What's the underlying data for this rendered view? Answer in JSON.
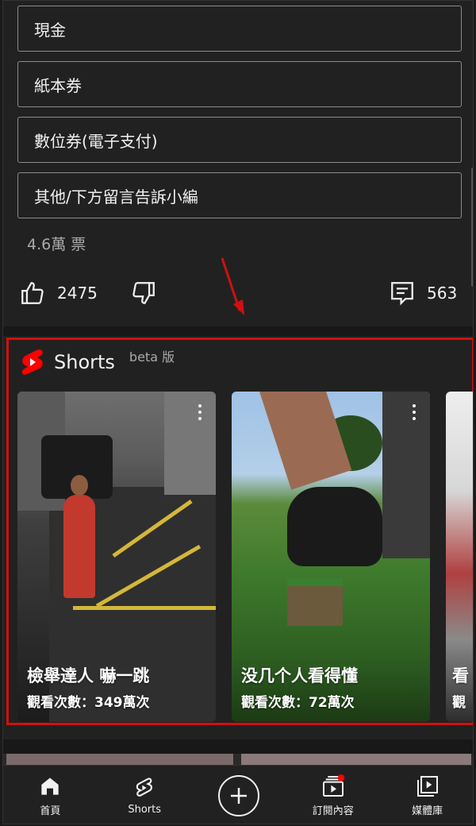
{
  "poll": {
    "options": [
      "現金",
      "紙本券",
      "數位券(電子支付)",
      "其他/下方留言告訴小編"
    ],
    "votes": "4.6萬 票"
  },
  "actions": {
    "likes": "2475",
    "comments": "563"
  },
  "shorts": {
    "title": "Shorts",
    "beta": "beta 版",
    "cards": [
      {
        "title": "檢舉達人 嚇一跳",
        "views": "觀看次數：349萬次"
      },
      {
        "title": "没几个人看得懂",
        "views": "觀看次數：72萬次"
      },
      {
        "title": "看",
        "views": "觀"
      }
    ]
  },
  "nav": {
    "items": [
      "首頁",
      "Shorts",
      "",
      "訂閱內容",
      "媒體庫"
    ]
  },
  "colors": {
    "background": "#212121",
    "highlight": "#d01010",
    "shorts_red": "#ff0000",
    "text": "#f1f1f1",
    "muted": "#aaaaaa"
  }
}
